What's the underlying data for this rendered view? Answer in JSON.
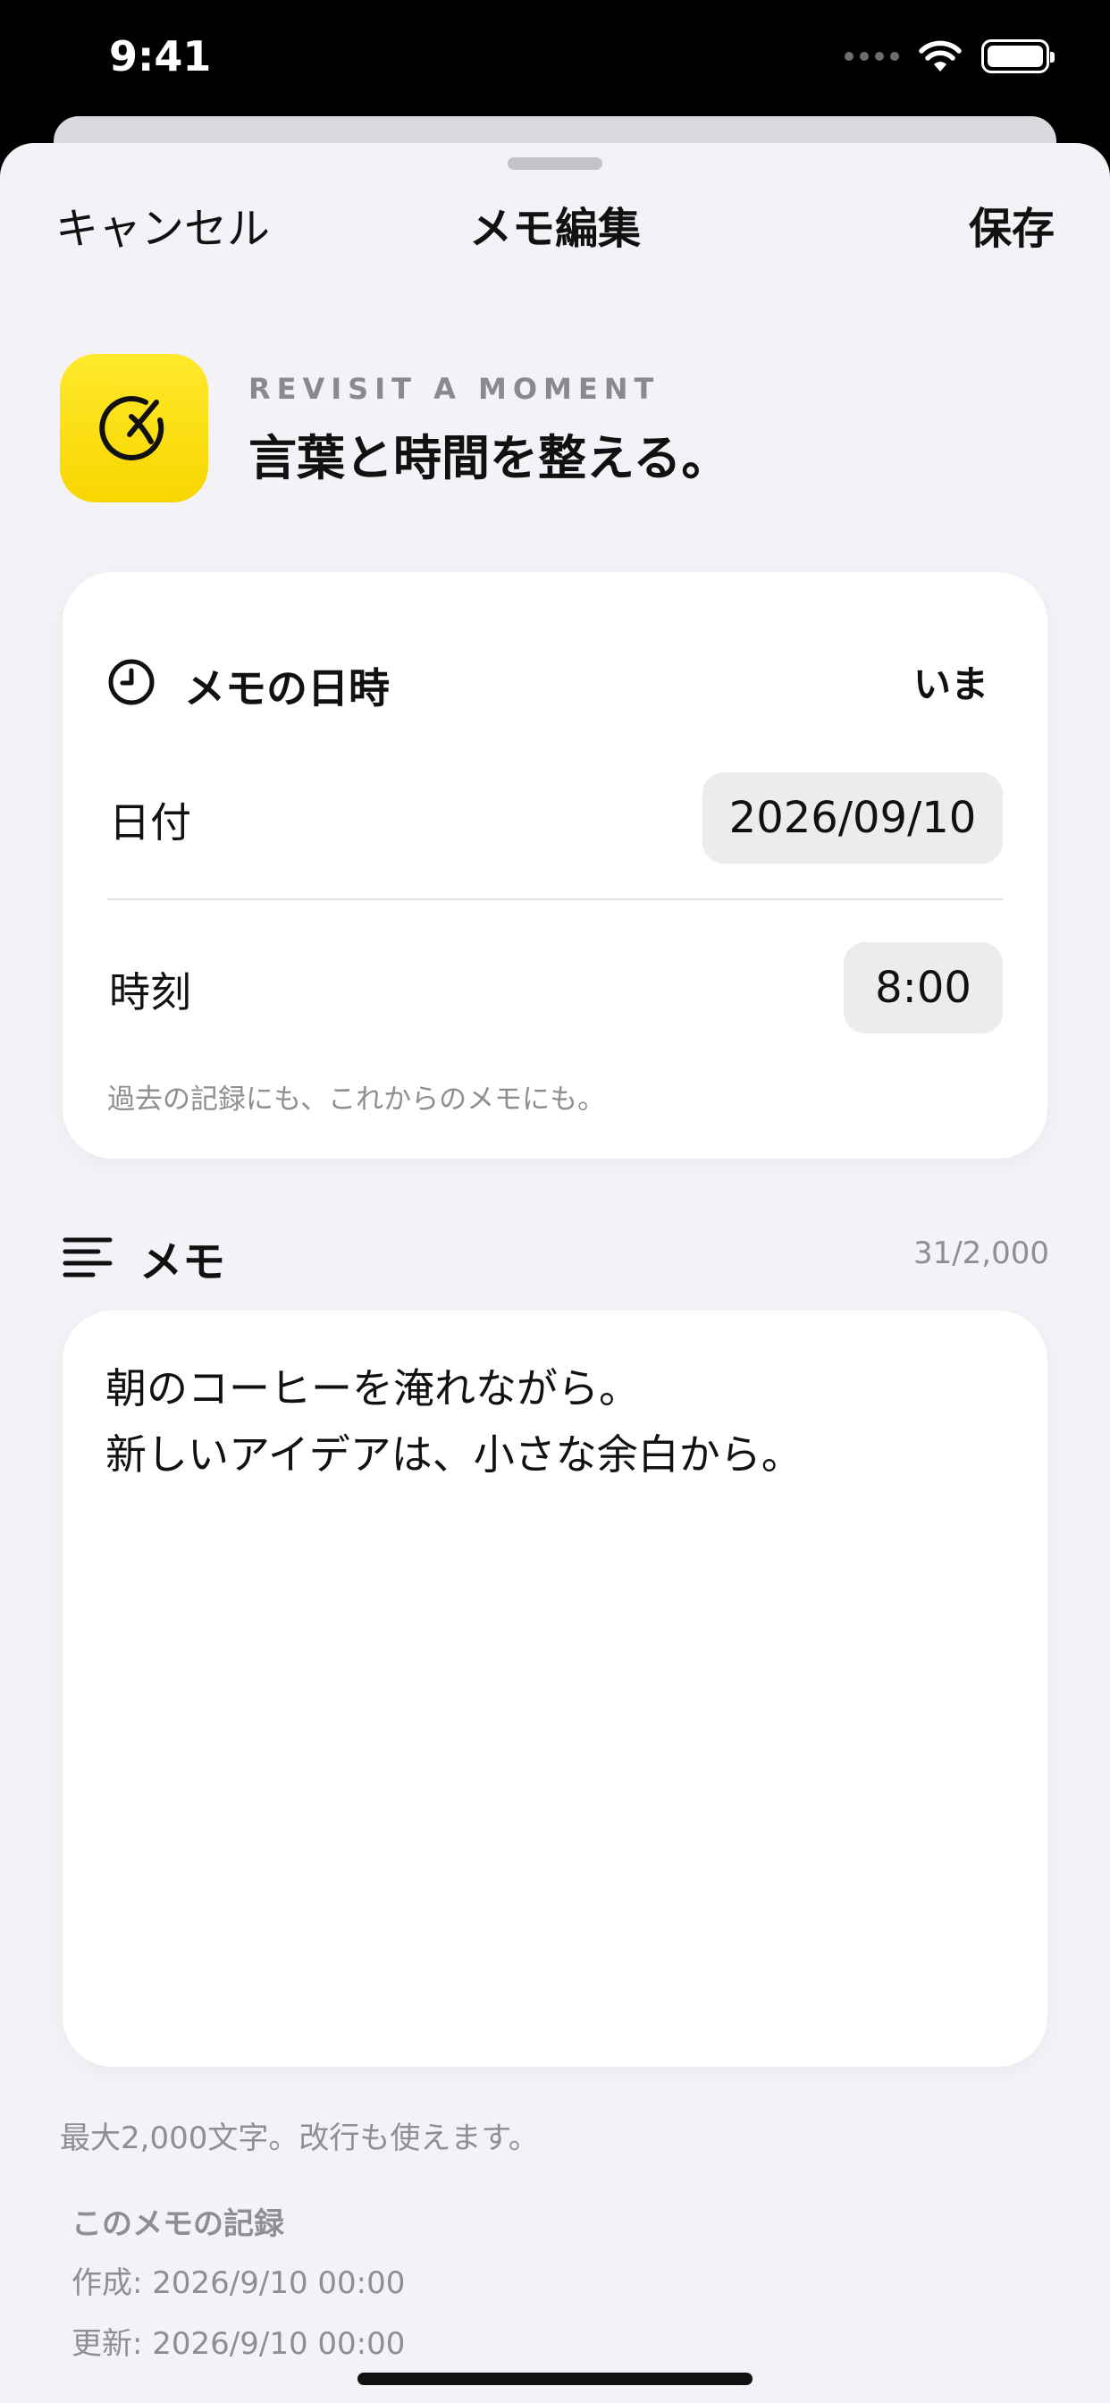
{
  "status_bar": {
    "time": "9:41"
  },
  "nav": {
    "cancel_label": "キャンセル",
    "title": "メモ編集",
    "save_label": "保存"
  },
  "hero": {
    "eyebrow": "REVISIT A MOMENT",
    "title": "言葉と時間を整える。",
    "icon": "pencil-circle-icon",
    "accent": "#FFE000"
  },
  "datetime": {
    "title": "メモの日時",
    "now_label": "いま",
    "date_label": "日付",
    "date_value": "2026/09/10",
    "time_label": "時刻",
    "time_value": "8:00",
    "hint": "過去の記録にも、これからのメモにも。"
  },
  "memo": {
    "title": "メモ",
    "count": "31/2,000",
    "text": "朝のコーヒーを淹れながら。\n新しいアイデアは、小さな余白から。",
    "hint": "最大2,000文字。改行も使えます。"
  },
  "record": {
    "title": "このメモの記録",
    "created": "作成: 2026/9/10 00:00",
    "updated": "更新: 2026/9/10 00:00"
  }
}
